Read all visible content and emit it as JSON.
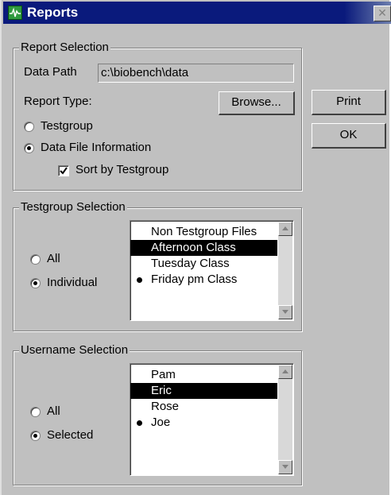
{
  "window": {
    "title": "Reports",
    "icon": "heartbeat-icon",
    "close_glyph": "✕"
  },
  "report_selection": {
    "title": "Report Selection",
    "data_path_label": "Data Path",
    "data_path_value": "c:\\biobench\\data",
    "report_type_label": "Report Type:",
    "browse_label": "Browse...",
    "options": [
      {
        "label": "Testgroup",
        "selected": false
      },
      {
        "label": "Data File Information",
        "selected": true
      }
    ],
    "sort_checkbox": {
      "label": "Sort by Testgroup",
      "checked": true
    }
  },
  "buttons": {
    "print_label": "Print",
    "ok_label": "OK"
  },
  "testgroup_selection": {
    "title": "Testgroup Selection",
    "options": [
      {
        "label": "All",
        "selected": false
      },
      {
        "label": "Individual",
        "selected": true
      }
    ],
    "items": [
      {
        "label": "Non Testgroup Files",
        "selected": false,
        "bullet": false
      },
      {
        "label": "Afternoon Class",
        "selected": true,
        "bullet": false
      },
      {
        "label": "Tuesday Class",
        "selected": false,
        "bullet": false
      },
      {
        "label": "Friday pm Class",
        "selected": false,
        "bullet": true
      }
    ]
  },
  "username_selection": {
    "title": "Username Selection",
    "options": [
      {
        "label": "All",
        "selected": false
      },
      {
        "label": "Selected",
        "selected": true
      }
    ],
    "items": [
      {
        "label": "Pam",
        "selected": false,
        "bullet": false
      },
      {
        "label": "Eric",
        "selected": true,
        "bullet": false
      },
      {
        "label": "Rose",
        "selected": false,
        "bullet": false
      },
      {
        "label": "Joe",
        "selected": false,
        "bullet": true
      }
    ]
  },
  "colors": {
    "titlebar": "#0a1a7c",
    "face": "#c0c0c0",
    "selection": "#000000"
  }
}
